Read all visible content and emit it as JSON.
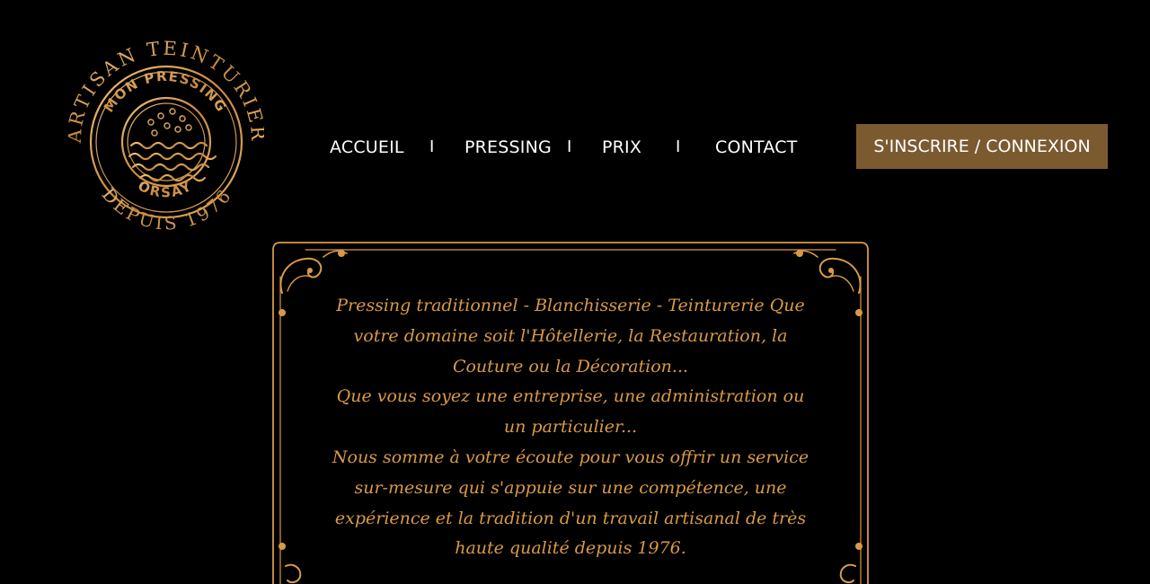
{
  "logo": {
    "top_arc": "ARTISAN TEINTURIER",
    "brand": "MON PRESSING",
    "city": "ORSAY",
    "bottom_arc": "DEPUIS 1976"
  },
  "nav": {
    "items": [
      "ACCUEIL",
      "PRESSING",
      "PRIX",
      "CONTACT"
    ],
    "separator": "I"
  },
  "cta": {
    "label": "S'INSCRIRE / CONNEXION"
  },
  "intro": {
    "paragraphs": [
      "Pressing traditionnel - Blanchisserie - Teinturerie Que votre domaine soit l'Hôtellerie, la Restauration, la Couture ou la Décoration...",
      "Que vous soyez une entreprise, une administration ou un particulier...",
      "Nous somme à votre écoute pour vous offrir un service sur-mesure qui s'appuie sur une compétence, une expérience et la tradition d'un travail artisanal de très haute qualité depuis 1976."
    ]
  },
  "colors": {
    "background": "#000000",
    "gold": "#d99a45",
    "cta_background": "#7c5a30",
    "nav_text": "#ffffff"
  }
}
